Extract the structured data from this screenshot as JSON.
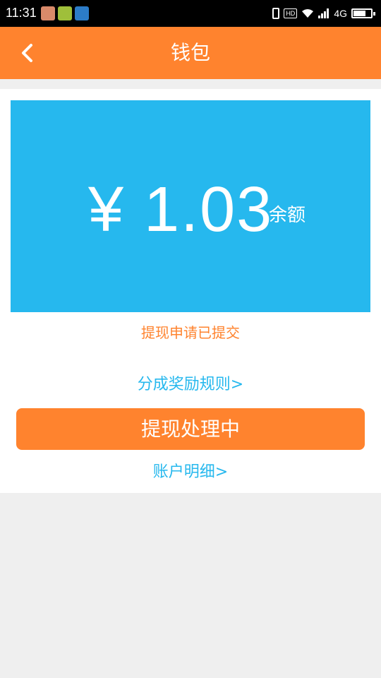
{
  "statusbar": {
    "time": "11:31",
    "hd": "HD",
    "network": "4G",
    "battery_level": 0.7
  },
  "header": {
    "title": "钱包",
    "back_icon": "chevron-left-icon"
  },
  "wallet": {
    "amount": "¥ 1.03",
    "amount_label": "余额",
    "card_color": "#26b8ee"
  },
  "withdraw": {
    "status_text": "提现申请已提交",
    "rules_link": "分成奖励规则>",
    "button_label": "提现处理中",
    "account_link": "账户明细>"
  },
  "colors": {
    "accent": "#ff832e",
    "link": "#26b8ee",
    "background": "#efefef"
  }
}
